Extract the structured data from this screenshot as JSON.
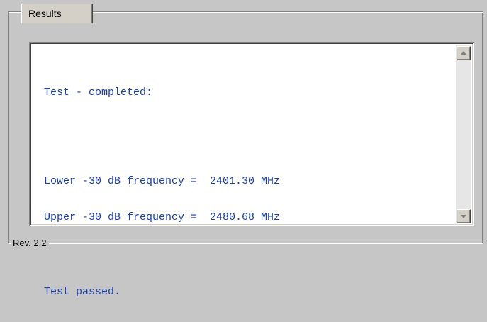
{
  "group": {
    "caption": "Results",
    "footer": "Rev. 2.2"
  },
  "output": {
    "lines": [
      "Test - completed:",
      "Lower -30 dB frequency =  2401.30 MHz",
      "Upper -30 dB frequency =  2480.68 MHz",
      "Test passed."
    ],
    "text_color": "#1a3fa8"
  },
  "scrollbar": {
    "up_icon": "arrow-up-icon",
    "down_icon": "arrow-down-icon"
  }
}
